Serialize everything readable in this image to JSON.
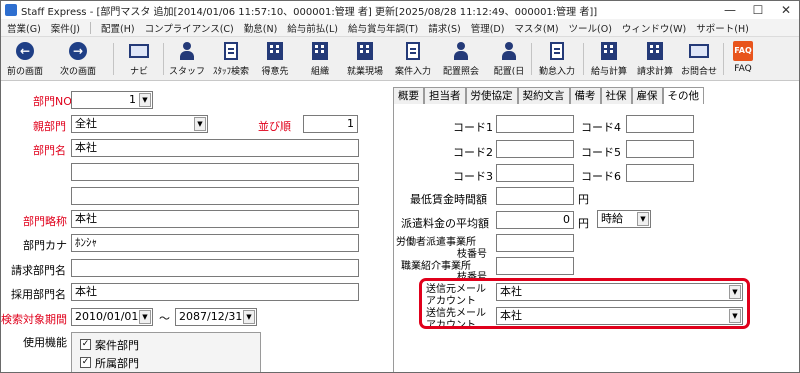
{
  "window": {
    "app_name": "Staff Express",
    "title": "Staff Express - [部門マスタ  追加[2014/01/06 11:57:10、000001:管理    者]  更新[2025/08/28 11:12:49、000001:管理    者]]",
    "min_label": "—",
    "max_label": "☐",
    "close_label": "✕"
  },
  "menu": [
    "営業(G)",
    "案件(J)",
    "配置(H)",
    "コンプライアンス(C)",
    "勤怠(N)",
    "給与前払(L)",
    "給与賞与年調(T)",
    "請求(S)",
    "管理(D)",
    "マスタ(M)",
    "ツール(O)",
    "ウィンドウ(W)",
    "サポート(H)"
  ],
  "toolbar": {
    "prev": "前の画面",
    "next": "次の画面",
    "navi": "ナビ",
    "staff": "スタッフ",
    "staff_search": "ｽﾀｯﾌ検索",
    "client": "得意先",
    "org": "組織",
    "site": "就業現場",
    "job_entry": "案件入力",
    "place_inquiry": "配置照会",
    "place_day": "配置(日",
    "attendance": "勤怠入力",
    "payroll": "給与計算",
    "billing": "請求計算",
    "inquiry": "お問合せ",
    "faq": "FAQ",
    "faq_icon_text": "FAQ"
  },
  "form": {
    "dept_no": {
      "label": "部門NO",
      "value": "1"
    },
    "parent_dept": {
      "label": "親部門",
      "value": "全社"
    },
    "order": {
      "label": "並び順",
      "value": "1"
    },
    "dept_name": {
      "label": "部門名",
      "value": "本社",
      "line2": "",
      "line3": ""
    },
    "dept_short": {
      "label": "部門略称",
      "value": "本社"
    },
    "dept_kana": {
      "label": "部門カナ",
      "value": "ﾎﾝｼｬ"
    },
    "bill_dept": {
      "label": "請求部門名",
      "value": ""
    },
    "hire_dept": {
      "label": "採用部門名",
      "value": "本社"
    },
    "search_period": {
      "label": "検索対象期間",
      "from": "2010/01/01",
      "sep": "〜",
      "to": "2087/12/31"
    },
    "usage": {
      "label": "使用機能",
      "items": [
        "案件部門",
        "所属部門"
      ],
      "check": "✓"
    }
  },
  "tabs": [
    "概要",
    "担当者",
    "労使協定",
    "契約文言",
    "備考",
    "社保",
    "雇保",
    "その他"
  ],
  "other_tab": {
    "code1": {
      "label": "コード1",
      "value": ""
    },
    "code2": {
      "label": "コード2",
      "value": ""
    },
    "code3": {
      "label": "コード3",
      "value": ""
    },
    "code4": {
      "label": "コード4",
      "value": ""
    },
    "code5": {
      "label": "コード5",
      "value": ""
    },
    "code6": {
      "label": "コード6",
      "value": ""
    },
    "min_wage": {
      "label": "最低賃金時間額",
      "value": "",
      "unit": "円"
    },
    "avg_fee": {
      "label": "派遣料金の平均額",
      "value": "0",
      "unit": "円",
      "period": "時給"
    },
    "dispatch_branch": {
      "label1": "労働者派遣事業所",
      "label2": "枝番号",
      "value": ""
    },
    "placement_branch": {
      "label1": "職業紹介事業所",
      "label2": "枝番号",
      "value": ""
    },
    "sender_mail": {
      "label1": "送信元メール",
      "label2": "アカウント",
      "value": "本社"
    },
    "dest_mail": {
      "label1": "送信先メール",
      "label2": "アカウント",
      "value": "本社"
    }
  }
}
